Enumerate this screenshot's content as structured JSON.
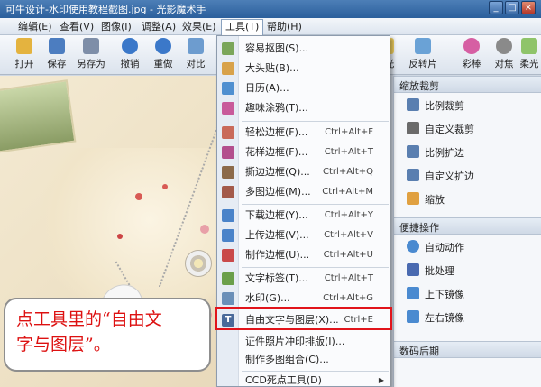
{
  "window": {
    "title": "可牛设计-水印使用教程截图.jpg - 光影魔术手",
    "min": "_",
    "max": "□",
    "close": "×"
  },
  "menubar": {
    "items": [
      {
        "label": "编辑(E)"
      },
      {
        "label": "查看(V)"
      },
      {
        "label": "图像(I)"
      },
      {
        "label": "调整(A)"
      },
      {
        "label": "效果(E)"
      },
      {
        "label": "工具(T)"
      },
      {
        "label": "帮助(H)"
      }
    ]
  },
  "toolbar": {
    "buttons": [
      {
        "label": "打开",
        "icon": "folder-icon",
        "color": "#e4b33f"
      },
      {
        "label": "保存",
        "icon": "save-icon",
        "color": "#4c7dc0"
      },
      {
        "label": "另存为",
        "icon": "save-as-icon",
        "color": "#7e8ea8"
      },
      {
        "label": "撤销",
        "icon": "undo-icon",
        "color": "#3b78c9"
      },
      {
        "label": "重做",
        "icon": "redo-icon",
        "color": "#3b78c9"
      },
      {
        "label": "对比",
        "icon": "compare-icon",
        "color": "#6d9ccf"
      }
    ],
    "right_buttons": [
      {
        "label": "光",
        "icon": "light-icon",
        "color": "#f0d060"
      },
      {
        "label": "反转片",
        "icon": "film-icon",
        "color": "#6aa2d6"
      },
      {
        "label": "彩棒",
        "icon": "color-bar-icon",
        "color": "#d65fa3"
      },
      {
        "label": "对焦",
        "icon": "focus-icon",
        "color": "#8a8a8a"
      },
      {
        "label": "柔光",
        "icon": "soft-light-icon",
        "color": "#8fc46a"
      }
    ]
  },
  "tools_menu": {
    "items": [
      {
        "label": "容易抠图(S)...",
        "shortcut": "",
        "icon": "cutout-icon",
        "color": "#7aa65a"
      },
      {
        "label": "大头贴(B)...",
        "shortcut": "",
        "icon": "sticker-icon",
        "color": "#d8a24a"
      },
      {
        "label": "日历(A)...",
        "shortcut": "",
        "icon": "calendar-icon",
        "color": "#4e8fd0"
      },
      {
        "label": "趣味涂鸦(T)...",
        "shortcut": "",
        "icon": "doodle-icon",
        "color": "#c85a9a"
      },
      {
        "label": "轻松边框(F)...",
        "shortcut": "Ctrl+Alt+F",
        "icon": "frame-icon",
        "color": "#c96a5a"
      },
      {
        "label": "花样边框(F)...",
        "shortcut": "Ctrl+Alt+T",
        "icon": "pattern-frame-icon",
        "color": "#b34f8d"
      },
      {
        "label": "撕边边框(Q)...",
        "shortcut": "Ctrl+Alt+Q",
        "icon": "torn-frame-icon",
        "color": "#8c6a4a"
      },
      {
        "label": "多图边框(M)...",
        "shortcut": "Ctrl+Alt+M",
        "icon": "multi-frame-icon",
        "color": "#a35a4a"
      },
      {
        "label": "下载边框(Y)...",
        "shortcut": "Ctrl+Alt+Y",
        "icon": "download-frame-icon",
        "color": "#4a83c9"
      },
      {
        "label": "上传边框(V)...",
        "shortcut": "Ctrl+Alt+V",
        "icon": "upload-frame-icon",
        "color": "#4a83c9"
      },
      {
        "label": "制作边框(U)...",
        "shortcut": "Ctrl+Alt+U",
        "icon": "make-frame-icon",
        "color": "#c94a4a"
      },
      {
        "label": "文字标签(T)...",
        "shortcut": "Ctrl+Alt+T",
        "icon": "text-tag-icon",
        "color": "#6a9f4a"
      },
      {
        "label": "水印(G)...",
        "shortcut": "Ctrl+Alt+G",
        "icon": "watermark-icon",
        "color": "#6a8fb8"
      },
      {
        "label": "自由文字与图层(X)...",
        "shortcut": "Ctrl+E",
        "icon": "text-layer-icon",
        "color": "#4a6a9a"
      },
      {
        "label": "证件照片冲印排版(I)...",
        "shortcut": "",
        "icon": "",
        "color": ""
      },
      {
        "label": "制作多图组合(C)...",
        "shortcut": "",
        "icon": "",
        "color": ""
      },
      {
        "label": "CCD死点工具(D)",
        "shortcut": "",
        "icon": "",
        "color": ""
      }
    ]
  },
  "right_panel": {
    "sections": [
      {
        "title": "缩放裁剪",
        "items": [
          {
            "label": "比例裁剪",
            "icon": "ratio-crop-icon",
            "color": "#5a7fb0"
          },
          {
            "label": "自定义裁剪",
            "icon": "custom-crop-icon",
            "color": "#6a6a6a"
          },
          {
            "label": "比例扩边",
            "icon": "ratio-expand-icon",
            "color": "#5a7fb0"
          },
          {
            "label": "自定义扩边",
            "icon": "custom-expand-icon",
            "color": "#5a7fb0"
          },
          {
            "label": "缩放",
            "icon": "zoom-icon",
            "color": "#e0a040"
          }
        ]
      },
      {
        "title": "便捷操作",
        "items": [
          {
            "label": "自动动作",
            "icon": "auto-action-icon",
            "color": "#4a8ad0"
          },
          {
            "label": "批处理",
            "icon": "batch-icon",
            "color": "#4a6ab0"
          },
          {
            "label": "上下镜像",
            "icon": "flip-vertical-icon",
            "color": "#4a8ad0"
          },
          {
            "label": "左右镜像",
            "icon": "flip-horizontal-icon",
            "color": "#4a8ad0"
          }
        ]
      },
      {
        "title": "数码后期",
        "items": []
      }
    ]
  },
  "callout": {
    "text_line1": "点工具里的“自由文",
    "text_line2": "字与图层”。"
  },
  "accent": {
    "highlight_border": "#e1141b",
    "callout_text": "#d11"
  }
}
